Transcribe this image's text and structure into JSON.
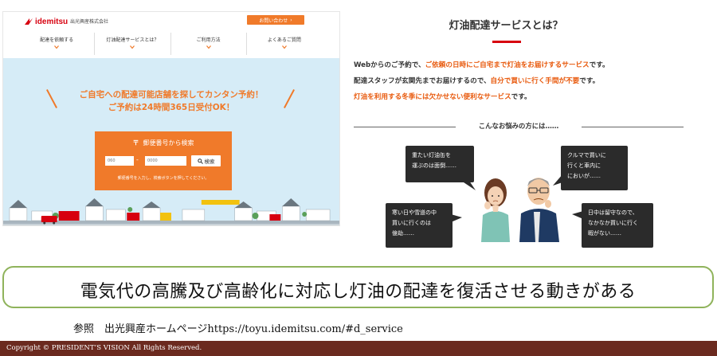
{
  "site": {
    "logo_text": "idemitsu",
    "company_name": "出光興産株式会社",
    "contact_button": "お問い合わせ",
    "nav": [
      {
        "label": "配達を依頼する"
      },
      {
        "label": "灯油配達サービスとは？"
      },
      {
        "label": "ご利用方法"
      },
      {
        "label": "よくあるご質問"
      }
    ],
    "hero": {
      "line1": "ご自宅への配達可能店舗を探してカンタン予約！",
      "line2": "ご予約は24時間365日受付OK！"
    },
    "search": {
      "postal_mark": "〒",
      "title": "郵便番号から検索",
      "zip1_placeholder": "060",
      "zip_dash": "-",
      "zip2_placeholder": "0000",
      "button_label": "検索",
      "note": "郵便番号を入力し、検索ボタンを押してください。"
    },
    "colors": {
      "brand_red": "#d7000f",
      "accent_orange": "#f07a2a",
      "sky": "#d6ecf7"
    }
  },
  "service": {
    "title": "灯油配達サービスとは？",
    "line1": {
      "a": "Webからのご予約で、",
      "hl": "ご依頼の日時にご自宅まで灯油をお届けするサービス",
      "b": "です。"
    },
    "line2": {
      "a": "配達スタッフが玄関先までお届けするので、",
      "hl": "自分で買いに行く手間が不要",
      "b": "です。"
    },
    "line3": {
      "hl": "灯油を利用する冬季には欠かせない便利なサービス",
      "b": "です。"
    },
    "worry_label": "こんなお悩みの方には……",
    "bubbles": [
      {
        "lines": [
          "重たい灯油缶を",
          "運ぶのは面倒……"
        ]
      },
      {
        "lines": [
          "クルマで買いに",
          "行くと車内に",
          "においが……"
        ]
      },
      {
        "lines": [
          "寒い日や雪道の中",
          "買いに行くのは",
          "億劫……"
        ]
      },
      {
        "lines": [
          "日中は留守なので、",
          "なかなか買いに行く",
          "暇がない……"
        ]
      }
    ]
  },
  "caption": {
    "headline": "電気代の高騰及び高齢化に対応し灯油の配達を復活させる動きがある",
    "reference": "参照　出光興産ホームページhttps://toyu.idemitsu.com/#d_service"
  },
  "footer": {
    "copyright": "Copyright © PRESIDENT’S VISION All Rights Reserved."
  }
}
